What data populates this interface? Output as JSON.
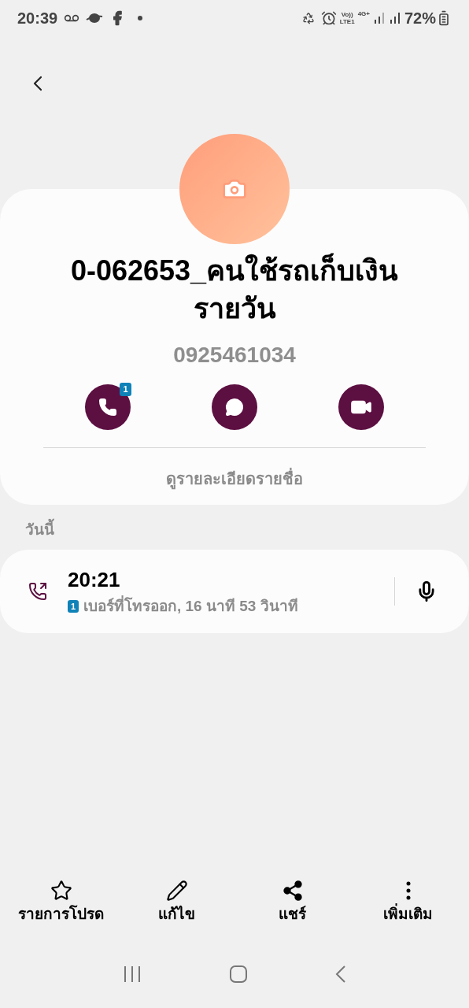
{
  "status_bar": {
    "time": "20:39",
    "volte": "Vo))",
    "lte": "LTE1",
    "network": "4G+",
    "battery": "72%"
  },
  "contact": {
    "name": "0-062653_คนใช้รถเก็บเงินรายวัน",
    "number": "0925461034",
    "actions": [
      {
        "kind": "call",
        "badge": "1"
      },
      {
        "kind": "message"
      },
      {
        "kind": "video"
      }
    ],
    "details_link": "ดูรายละเอียดรายชื่อ"
  },
  "history": {
    "heading": "วันนี้",
    "calls": [
      {
        "kind": "outgoing",
        "time": "20:21",
        "sim": "1",
        "detail": "เบอร์ที่โทรออก, 16 นาที 53 วินาที",
        "recording": true
      }
    ]
  },
  "bottom_bar": [
    {
      "kind": "favorite",
      "label": "รายการโปรด"
    },
    {
      "kind": "edit",
      "label": "แก้ไข"
    },
    {
      "kind": "share",
      "label": "แชร์"
    },
    {
      "kind": "more",
      "label": "เพิ่มเติม"
    }
  ]
}
